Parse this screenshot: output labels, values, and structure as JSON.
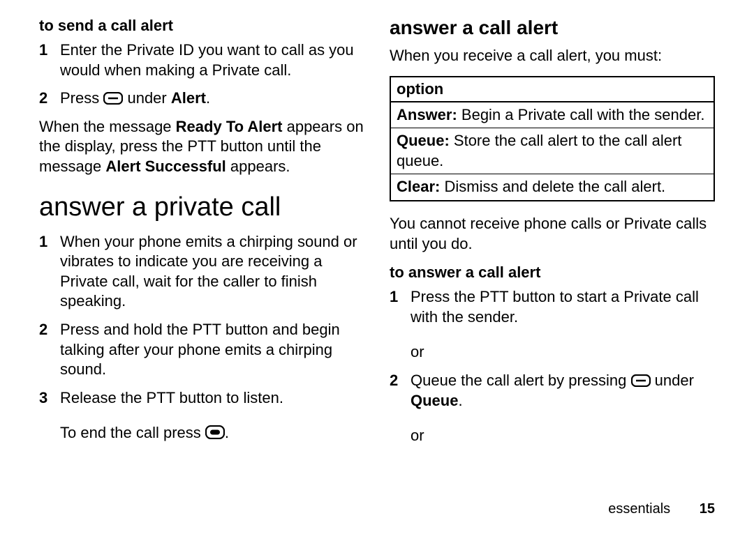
{
  "left": {
    "subhead1": "to send a call alert",
    "step1_num": "1",
    "step1_text": "Enter the Private ID you want to call as you would when making a Private call.",
    "step2_num": "2",
    "step2_pre": "Press ",
    "step2_post": " under ",
    "step2_bold": "Alert",
    "step2_end": ".",
    "para1_a": "When the message ",
    "para1_b": "Ready To Alert",
    "para1_c": " appears on the display, press the PTT button until the message ",
    "para1_d": "Alert Successful",
    "para1_e": " appears.",
    "h2": "answer a private call",
    "a_step1_num": "1",
    "a_step1_text": "When your phone emits a chirping sound or vibrates to indicate you are receiving a Private call, wait for the caller to finish speaking.",
    "a_step2_num": "2",
    "a_step2_text": "Press and hold the PTT button and begin talking after your phone emits a chirping sound.",
    "a_step3_num": "3",
    "a_step3_text": "Release the PTT button to listen.",
    "end_call_pre": "To end the call press ",
    "end_call_post": "."
  },
  "right": {
    "h3": "answer a call alert",
    "intro": "When you receive a call alert, you must:",
    "th": "option",
    "row1_label": "Answer:",
    "row1_text": " Begin a Private call with the sender.",
    "row2_label": "Queue:",
    "row2_text": " Store the call alert to the call alert queue.",
    "row3_label": "Clear:",
    "row3_text": " Dismiss and delete the call alert.",
    "after_table": "You cannot receive phone calls or Private calls until you do.",
    "subhead2": "to answer a call alert",
    "b_step1_num": "1",
    "b_step1_text": "Press the PTT button to start a Private call with the sender.",
    "or1": "or",
    "b_step2_num": "2",
    "b_step2_pre": "Queue the call alert by pressing ",
    "b_step2_post": " under ",
    "b_step2_bold": "Queue",
    "b_step2_end": ".",
    "or2": "or"
  },
  "footer": {
    "section": "essentials",
    "page": "15"
  }
}
